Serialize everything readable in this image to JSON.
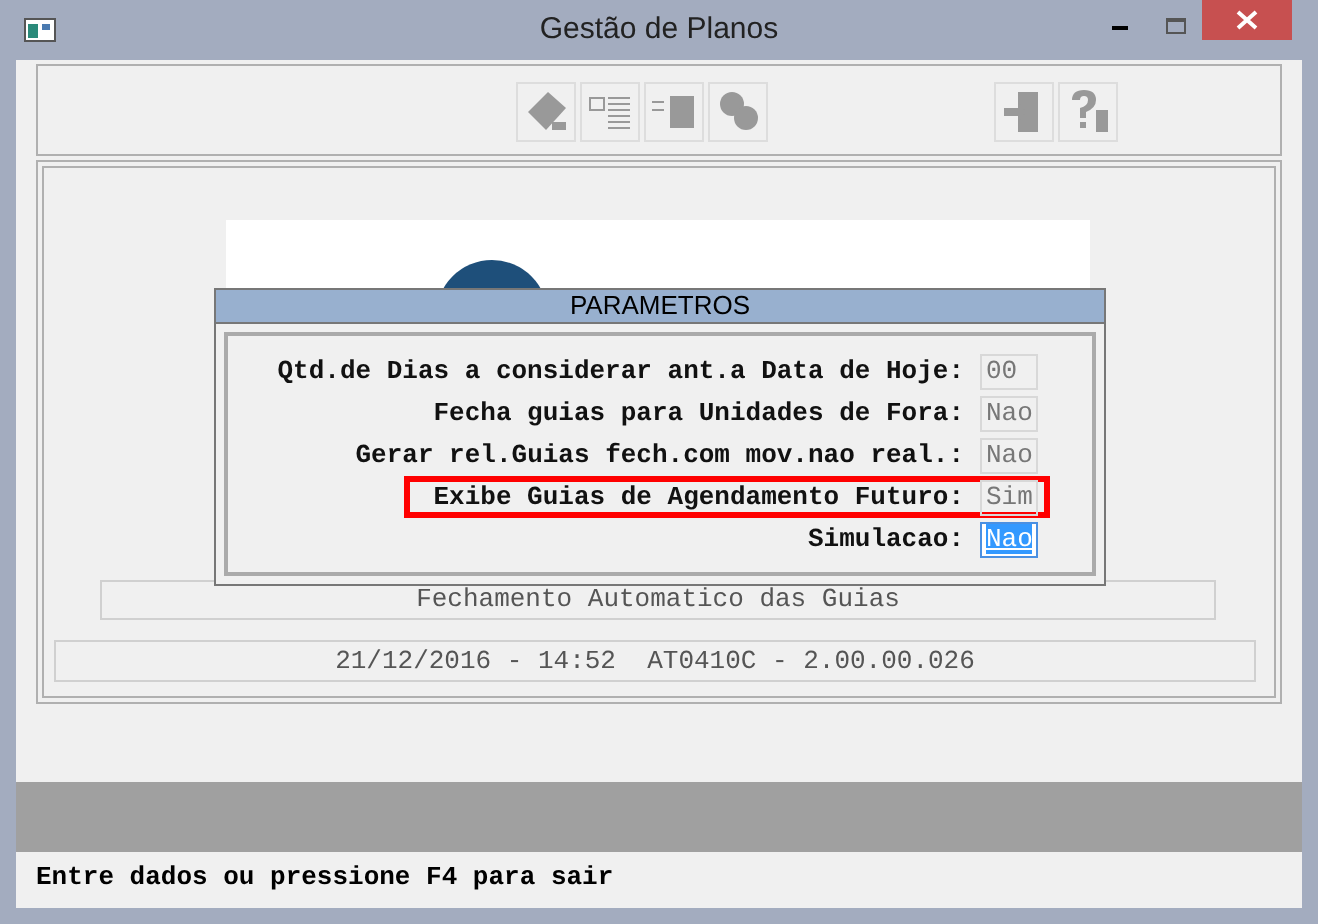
{
  "window": {
    "title": "Gestão de Planos"
  },
  "background": {
    "banner": "Fechamento Automatico das Guias",
    "version_line": "21/12/2016 - 14:52  AT0410C - 2.00.00.026"
  },
  "dialog": {
    "title": "PARAMETROS",
    "fields": [
      {
        "label": "Qtd.de Dias a considerar ant.a Data de Hoje:",
        "value": "00",
        "focused": false,
        "highlighted": false
      },
      {
        "label": "Fecha guias para Unidades de Fora:",
        "value": "Nao",
        "focused": false,
        "highlighted": false
      },
      {
        "label": "Gerar rel.Guias fech.com mov.nao real.:",
        "value": "Nao",
        "focused": false,
        "highlighted": false
      },
      {
        "label": "Exibe Guias de Agendamento Futuro:",
        "value": "Sim",
        "focused": false,
        "highlighted": true
      },
      {
        "label": "Simulacao:",
        "value": "Nao",
        "focused": true,
        "highlighted": false
      }
    ]
  },
  "status_bar": "Entre dados ou pressione F4 para sair"
}
